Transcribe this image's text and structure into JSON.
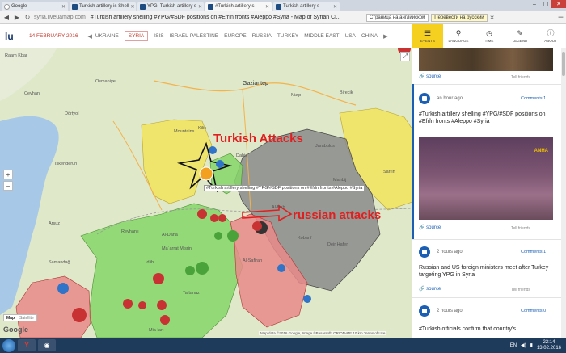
{
  "browser": {
    "tabs": [
      {
        "title": "Google",
        "icon": "google-icon"
      },
      {
        "title": "Turkish artillery is Shell",
        "icon": "liveuamap-icon"
      },
      {
        "title": "YPG: Turkish artillery s",
        "icon": "liveuamap-icon"
      },
      {
        "title": "#Turkish artillery s",
        "icon": "liveuamap-icon",
        "active": true
      },
      {
        "title": "Turkish artillery s",
        "icon": "liveuamap-icon"
      }
    ],
    "url_domain": "syria.liveuamap.com",
    "url_title": "#Turkish artillery shelling #YPG/#SDF positions on #Efrîn fronts #Aleppo #Syria - Map of Syrian Ci...",
    "translate_label": "Страница на английском",
    "translate_button": "Перевести на русский"
  },
  "site": {
    "logo": "lu",
    "date": "14 FEBRUARY 2016",
    "regions": [
      "UKRAINE",
      "SYRIA",
      "ISIS",
      "ISRAEL-PALESTINE",
      "EUROPE",
      "RUSSIA",
      "TURKEY",
      "MIDDLE EAST",
      "USA",
      "CHINA"
    ],
    "active_region": "SYRIA"
  },
  "panel_tabs": [
    {
      "label": "EVENTS",
      "icon": "events-icon",
      "active": true
    },
    {
      "label": "LANGUAGE",
      "icon": "language-icon"
    },
    {
      "label": "TIME",
      "icon": "clock-icon"
    },
    {
      "label": "LEGEND",
      "icon": "legend-icon"
    },
    {
      "label": "ABOUT",
      "icon": "info-icon"
    }
  ],
  "feed": {
    "source_label": "source",
    "tell_label": "Tell friends",
    "items": [
      {
        "ago": "an hour ago",
        "comments": "Comments 1",
        "text": "#Turkish artillery shelling #YPG/#SDF positions on #Efrîn fronts #Aleppo #Syria",
        "image_badge": "ANHA"
      },
      {
        "ago": "2 hours ago",
        "comments": "Comments 1",
        "text": "Russian and US foreign ministers meet after Turkey targeting YPG in Syria"
      },
      {
        "ago": "2 hours ago",
        "comments": "Comments 0",
        "text": "#Turkish officials confirm that country's"
      }
    ]
  },
  "map": {
    "annotations": {
      "turkish": "Turkish Attacks",
      "russian": "russian attacks"
    },
    "tooltip": "#Turkish artillery shelling #YPG/#SDF positions on #Efrîn fronts #Aleppo #Syria",
    "labels": [
      {
        "text": "Gaziantep",
        "cls": "big"
      },
      {
        "text": "Osmaniye"
      },
      {
        "text": "Ceyhan"
      },
      {
        "text": "Dörtyol"
      },
      {
        "text": "Iskenderun"
      },
      {
        "text": "Reyhanlı"
      },
      {
        "text": "Manbij"
      },
      {
        "text": "Al-Safirah"
      },
      {
        "text": "Idlib"
      },
      {
        "text": "Dabiq"
      },
      {
        "text": "Kilis"
      },
      {
        "text": "Nizip"
      },
      {
        "text": "Birecik"
      },
      {
        "text": "Jarabulus"
      },
      {
        "text": "Al-Bab"
      },
      {
        "text": "Al-Dana"
      },
      {
        "text": "Maʿarrat Misrin"
      },
      {
        "text": "Mountains"
      },
      {
        "text": "Taftanaz"
      },
      {
        "text": "Mia Iart"
      },
      {
        "text": "Arsuz"
      },
      {
        "text": "Sarrin"
      },
      {
        "text": "Deir Hafer"
      },
      {
        "text": "Raam Kbar"
      },
      {
        "text": "Kobanî"
      },
      {
        "text": "Samandağ"
      },
      {
        "text": "Jisr"
      },
      {
        "text": "Ariha"
      },
      {
        "text": "Afrin"
      },
      {
        "text": "Azaz"
      }
    ],
    "map_type": {
      "map": "Map",
      "satellite": "Satellite"
    },
    "google": "Google",
    "footer": "Map data ©2016 Google, Image ©Basarsoft, ORION-ME   10 km   Terms of Use"
  },
  "taskbar": {
    "lang": "EN",
    "time": "22:14",
    "date": "13.02.2016"
  }
}
